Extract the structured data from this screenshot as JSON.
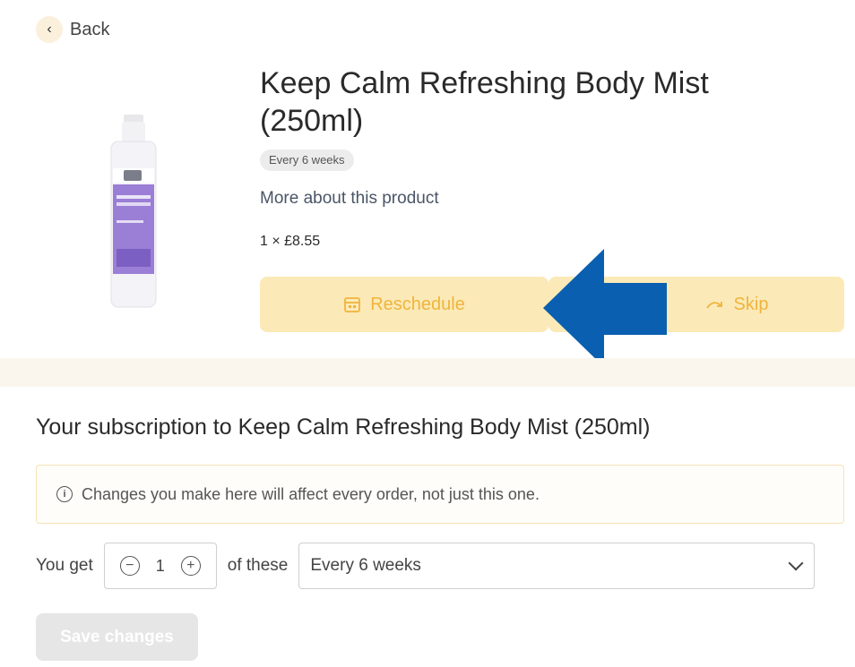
{
  "nav": {
    "back_label": "Back"
  },
  "product": {
    "title": "Keep Calm Refreshing Body Mist (250ml)",
    "frequency_badge": "Every 6 weeks",
    "more_link": "More about this product",
    "price": "1 × £8.55"
  },
  "actions": {
    "reschedule_label": "Reschedule",
    "skip_label": "Skip"
  },
  "subscription": {
    "heading": "Your subscription to Keep Calm Refreshing Body Mist (250ml)",
    "notice": "Changes you make here will affect every order, not just this one.",
    "you_get_label": "You get",
    "quantity": "1",
    "of_these_label": "of these",
    "frequency_selected": "Every 6 weeks",
    "save_label": "Save changes"
  },
  "colors": {
    "accent_button_bg": "#fbeab7",
    "accent_text": "#f0b43c",
    "annotation_arrow": "#0a5fb0"
  },
  "icons": [
    "chevron-left-icon",
    "calendar-icon",
    "skip-arrow-icon",
    "info-icon",
    "minus-circle-icon",
    "plus-circle-icon",
    "chevron-down-icon"
  ]
}
